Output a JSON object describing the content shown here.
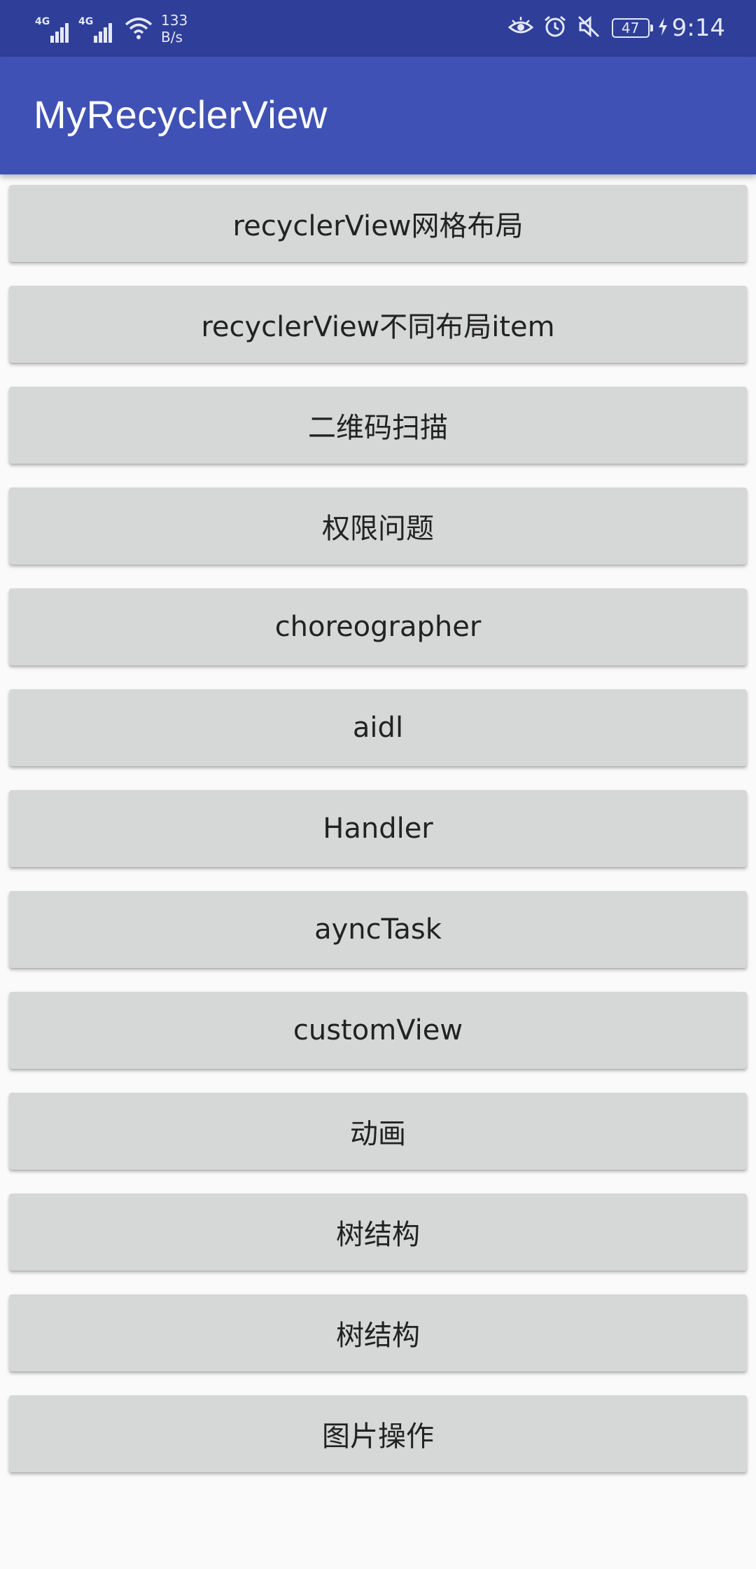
{
  "status_bar": {
    "net1": "4G",
    "net2": "4G",
    "speed_value": "133",
    "speed_unit": "B/s",
    "battery": "47",
    "time": "9:14",
    "icons": [
      "signal-icon",
      "signal-icon",
      "wifi-icon",
      "eye-icon",
      "alarm-icon",
      "mute-icon",
      "battery-icon",
      "charging-icon"
    ],
    "bg_color": "#2e3e99"
  },
  "app_bar": {
    "title": "MyRecyclerView",
    "color": "#3f51b5"
  },
  "items": [
    {
      "label": "recyclerView网格布局"
    },
    {
      "label": "recyclerView不同布局item"
    },
    {
      "label": "二维码扫描"
    },
    {
      "label": "权限问题"
    },
    {
      "label": "choreographer"
    },
    {
      "label": "aidl"
    },
    {
      "label": "Handler"
    },
    {
      "label": "ayncTask"
    },
    {
      "label": "customView"
    },
    {
      "label": "动画"
    },
    {
      "label": "树结构"
    },
    {
      "label": "树结构"
    },
    {
      "label": "图片操作"
    }
  ],
  "button_color": "#d6d7d7"
}
